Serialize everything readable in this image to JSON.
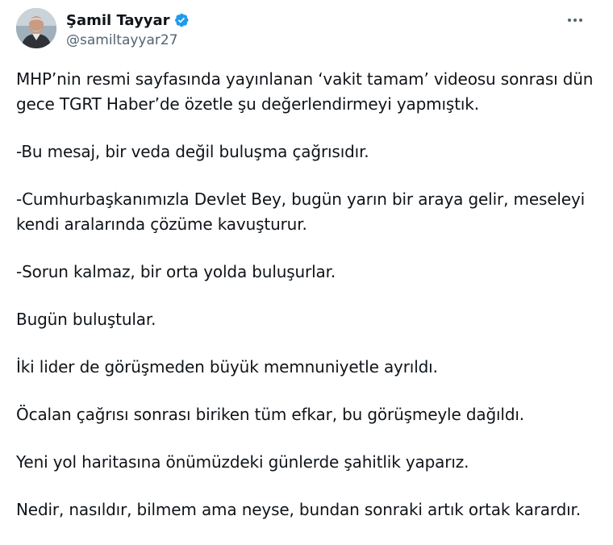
{
  "author": {
    "display_name": "Şamil Tayyar",
    "handle": "@samiltayyar27",
    "verified_color": "#1d9bf0"
  },
  "icons": {
    "avatar": "profile-photo",
    "verified": "verified-badge-icon",
    "more": "more-options-icon"
  },
  "tweet": {
    "paragraphs": [
      [
        "MHP’nin resmi sayfasında yayınlanan ‘vakit tamam’ videosu sonrası dün",
        "gece TGRT Haber’de özetle şu değerlendirmeyi yapmıştık."
      ],
      [
        "-Bu mesaj, bir veda değil buluşma çağrısıdır."
      ],
      [
        "-Cumhurbaşkanımızla Devlet Bey, bugün yarın bir araya gelir, meseleyi",
        "kendi aralarında çözüme kavuşturur."
      ],
      [
        "-Sorun kalmaz, bir orta yolda buluşurlar."
      ],
      [
        "Bugün buluştular."
      ],
      [
        "İki lider de görüşmeden büyük memnuniyetle ayrıldı."
      ],
      [
        "Öcalan çağrısı sonrası biriken tüm efkar, bu görüşmeyle dağıldı."
      ],
      [
        "Yeni yol haritasına önümüzdeki günlerde şahitlik yaparız."
      ],
      [
        "Nedir, nasıldır, bilmem ama neyse, bundan sonraki artık ortak karardır."
      ]
    ]
  }
}
